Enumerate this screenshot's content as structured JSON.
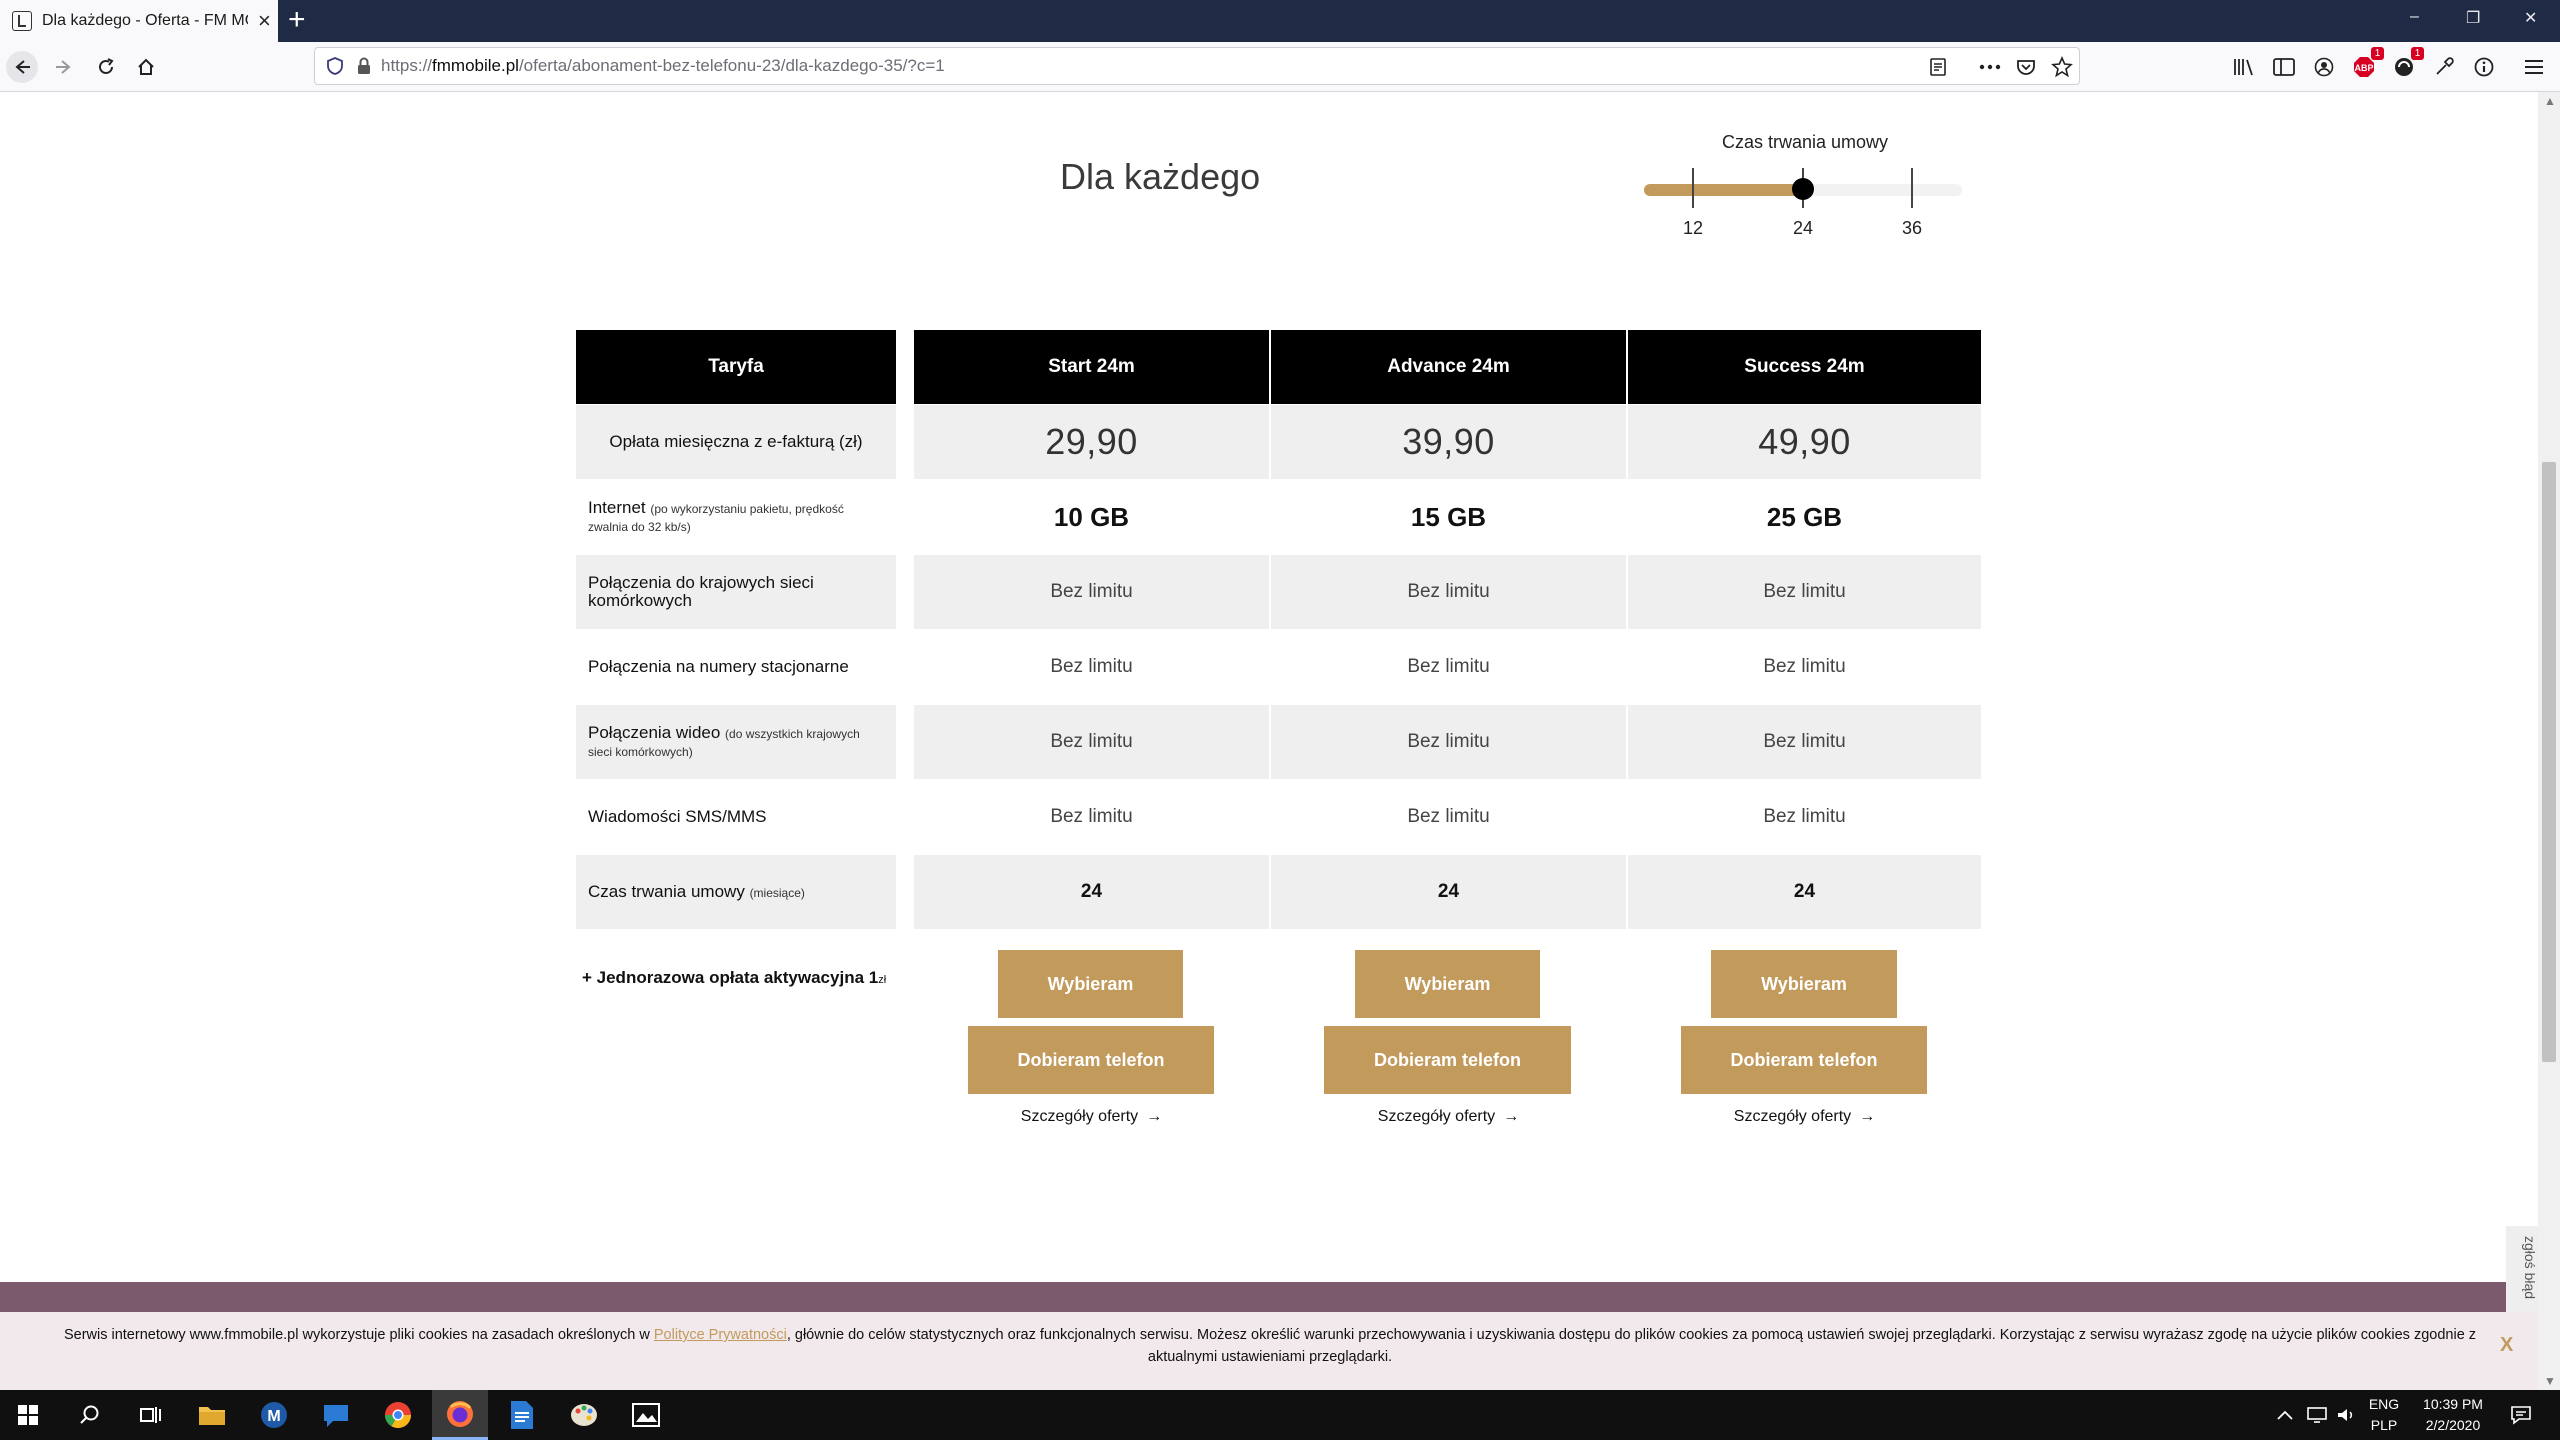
{
  "browser": {
    "tab_title": "Dla każdego - Oferta - FM MOBILE",
    "url_scheme": "https://",
    "url_host": "fmmobile.pl",
    "url_path": "/oferta/abonament-bez-telefonu-23/dla-kazdego-35/?c=1",
    "badges": {
      "adblock": "1",
      "ext": "1"
    },
    "window_controls": [
      "–",
      "❐",
      "✕"
    ]
  },
  "page": {
    "title": "Dla każdego",
    "duration": {
      "label": "Czas trwania umowy",
      "options": [
        "12",
        "24",
        "36"
      ],
      "selected": "24",
      "selected_fraction": 0.5
    },
    "table": {
      "header_label": "Taryfa",
      "plans": [
        {
          "name": "Start 24m",
          "price": "29,90",
          "internet": "10 GB",
          "mobile_calls": "Bez limitu",
          "landline_calls": "Bez limitu",
          "video_calls": "Bez limitu",
          "sms_mms": "Bez limitu",
          "duration": "24"
        },
        {
          "name": "Advance 24m",
          "price": "39,90",
          "internet": "15 GB",
          "mobile_calls": "Bez limitu",
          "landline_calls": "Bez limitu",
          "video_calls": "Bez limitu",
          "sms_mms": "Bez limitu",
          "duration": "24"
        },
        {
          "name": "Success 24m",
          "price": "49,90",
          "internet": "25 GB",
          "mobile_calls": "Bez limitu",
          "landline_calls": "Bez limitu",
          "video_calls": "Bez limitu",
          "sms_mms": "Bez limitu",
          "duration": "24"
        }
      ],
      "row_labels": {
        "price": "Opłata miesięczna z e-fakturą (zł)",
        "internet": "Internet",
        "internet_note": "(po wykorzystaniu pakietu, prędkość zwalnia do 32 kb/s)",
        "mobile_calls": "Połączenia do krajowych sieci komórkowych",
        "landline_calls": "Połączenia na numery stacjonarne",
        "video_calls": "Połączenia wideo",
        "video_note": "(do wszystkich krajowych sieci komórkowych)",
        "sms_mms": "Wiadomości SMS/MMS",
        "duration": "Czas trwania umowy",
        "duration_note": "(miesiące)"
      },
      "activation_fee": "+ Jednorazowa opłata aktywacyjna 1",
      "activation_unit": "zł",
      "choose_label": "Wybieram",
      "phone_label": "Dobieram telefon",
      "details_label": "Szczegóły oferty",
      "details_arrow": "→"
    },
    "report_tab": "zgłoś błąd",
    "cookie": {
      "text_before": "Serwis internetowy www.fmmobile.pl wykorzystuje pliki cookies na zasadach określonych w ",
      "link": "Polityce Prywatności",
      "text_after": ", głównie do celów statystycznych oraz funkcjonalnych serwisu. Możesz określić warunki przechowywania i uzyskiwania dostępu do plików cookies za pomocą ustawień swojej przeglądarki. Korzystając z serwisu wyrażasz zgodę na użycie plików cookies zgodnie z aktualnymi ustawieniami przeglądarki.",
      "close": "X"
    }
  },
  "taskbar": {
    "lang": "ENG",
    "layout": "PLP",
    "time": "10:39 PM",
    "date": "2/2/2020"
  },
  "colors": {
    "gold": "#c29a5c",
    "titlebar": "#1f2a44",
    "header_black": "#000000",
    "row_grey": "#efefef",
    "footer_mauve": "#7b5a6e"
  }
}
